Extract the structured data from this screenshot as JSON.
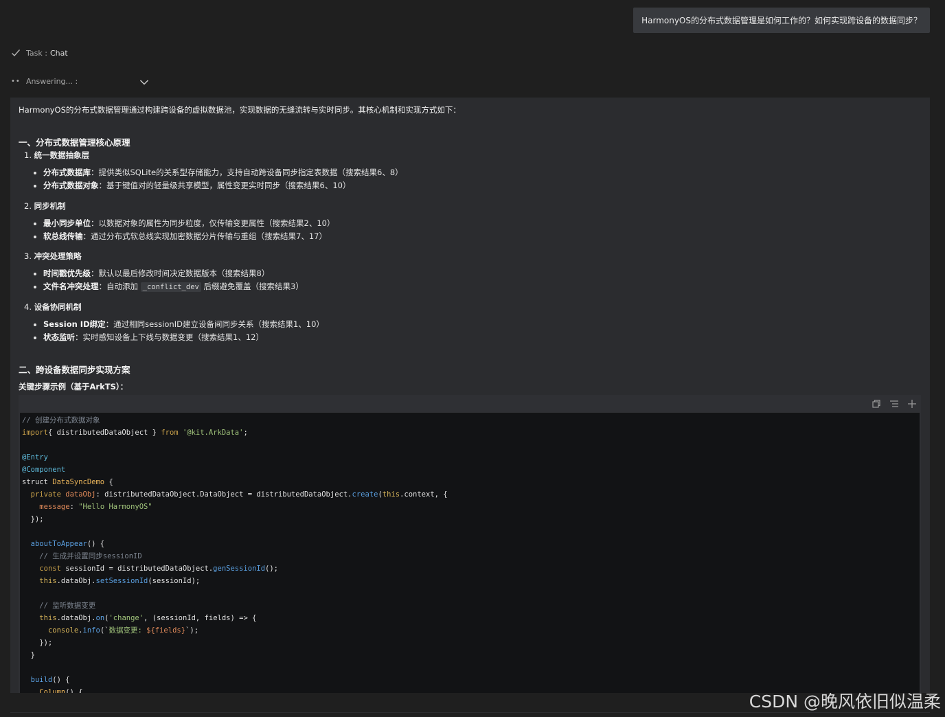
{
  "user_message": "HarmonyOS的分布式数据管理是如何工作的？如何实现跨设备的数据同步？",
  "task": {
    "label": "Task :",
    "value": "Chat"
  },
  "status": {
    "label": "Answering... :"
  },
  "answer": {
    "intro": "HarmonyOS的分布式数据管理通过构建跨设备的虚拟数据池，实现数据的无缝流转与实时同步。其核心机制和实现方式如下：",
    "section1_title": "一、分布式数据管理核心原理",
    "s1_1_num": "1. ",
    "s1_1_title": "统一数据抽象层",
    "s1_1_items": [
      {
        "b": "分布式数据库",
        "t": "：提供类似SQLite的关系型存储能力，支持自动跨设备同步指定表数据（搜索结果6、8）"
      },
      {
        "b": "分布式数据对象",
        "t": "：基于键值对的轻量级共享模型，属性变更实时同步（搜索结果6、10）"
      }
    ],
    "s1_2_num": "2. ",
    "s1_2_title": "同步机制",
    "s1_2_items": [
      {
        "b": "最小同步单位",
        "t": "：以数据对象的属性为同步粒度，仅传输变更属性（搜索结果2、10）"
      },
      {
        "b": "软总线传输",
        "t": "：通过分布式软总线实现加密数据分片传输与重组（搜索结果7、17）"
      }
    ],
    "s1_3_num": "3. ",
    "s1_3_title": "冲突处理策略",
    "s1_3_item1": {
      "b": "时间戳优先级",
      "t": "：默认以最后修改时间决定数据版本（搜索结果8）"
    },
    "s1_3_item2": {
      "b": "文件名冲突处理",
      "pre": "：自动添加 ",
      "code": "_conflict_dev",
      "post": " 后缀避免覆盖（搜索结果3）"
    },
    "s1_4_num": "4. ",
    "s1_4_title": "设备协同机制",
    "s1_4_items": [
      {
        "b": "Session ID绑定",
        "t": "：通过相同sessionID建立设备间同步关系（搜索结果1、10）"
      },
      {
        "b": "状态监听",
        "t": "：实时感知设备上下线与数据变更（搜索结果1、12）"
      }
    ],
    "section2_title": "二、跨设备数据同步实现方案",
    "steps_label": "关键步骤示例（基于ArkTS）："
  },
  "code": {
    "lines": [
      [
        [
          "c-cm",
          "// 创建分布式数据对象"
        ]
      ],
      [
        [
          "c-kw",
          "import"
        ],
        [
          "",
          "{ distributedDataObject } "
        ],
        [
          "c-kw",
          "from"
        ],
        [
          "",
          " "
        ],
        [
          "c-str",
          "'@kit.ArkData'"
        ],
        [
          "",
          ";"
        ]
      ],
      [],
      [
        [
          "c-dec",
          "@Entry"
        ]
      ],
      [
        [
          "c-dec",
          "@Component"
        ]
      ],
      [
        [
          "",
          "struct "
        ],
        [
          "c-ty",
          "DataSyncDemo"
        ],
        [
          "",
          " {"
        ]
      ],
      [
        [
          "",
          "  "
        ],
        [
          "c-kw",
          "private"
        ],
        [
          "",
          " "
        ],
        [
          "c-var",
          "dataObj"
        ],
        [
          "",
          ": distributedDataObject.DataObject = distributedDataObject."
        ],
        [
          "c-fn",
          "create"
        ],
        [
          "",
          "("
        ],
        [
          "c-this",
          "this"
        ],
        [
          "",
          ".context, {"
        ]
      ],
      [
        [
          "",
          "    "
        ],
        [
          "c-var",
          "message"
        ],
        [
          "",
          ": "
        ],
        [
          "c-str",
          "\"Hello HarmonyOS\""
        ]
      ],
      [
        [
          "",
          "  });"
        ]
      ],
      [],
      [
        [
          "",
          "  "
        ],
        [
          "c-fn",
          "aboutToAppear"
        ],
        [
          "",
          "() {"
        ]
      ],
      [
        [
          "",
          "    "
        ],
        [
          "c-cm",
          "// 生成并设置同步sessionID"
        ]
      ],
      [
        [
          "",
          "    "
        ],
        [
          "c-kw",
          "const"
        ],
        [
          "",
          " sessionId = distributedDataObject."
        ],
        [
          "c-fn",
          "genSessionId"
        ],
        [
          "",
          "();"
        ]
      ],
      [
        [
          "",
          "    "
        ],
        [
          "c-this",
          "this"
        ],
        [
          "",
          ".dataObj."
        ],
        [
          "c-fn",
          "setSessionId"
        ],
        [
          "",
          "(sessionId);"
        ]
      ],
      [],
      [
        [
          "",
          "    "
        ],
        [
          "c-cm",
          "// 监听数据变更"
        ]
      ],
      [
        [
          "",
          "    "
        ],
        [
          "c-this",
          "this"
        ],
        [
          "",
          ".dataObj."
        ],
        [
          "c-fn",
          "on"
        ],
        [
          "",
          "("
        ],
        [
          "c-str",
          "'change'"
        ],
        [
          "",
          ", (sessionId, fields) => {"
        ]
      ],
      [
        [
          "",
          "      "
        ],
        [
          "c-this",
          "console"
        ],
        [
          "",
          "."
        ],
        [
          "c-fn",
          "info"
        ],
        [
          "",
          "(`"
        ],
        [
          "c-str",
          "数据变更: "
        ],
        [
          "c-var",
          "${fields}"
        ],
        [
          "",
          "`);"
        ]
      ],
      [
        [
          "",
          "    });"
        ]
      ],
      [
        [
          "",
          "  }"
        ]
      ],
      [],
      [
        [
          "",
          "  "
        ],
        [
          "c-fn",
          "build"
        ],
        [
          "",
          "() {"
        ]
      ],
      [
        [
          "",
          "    "
        ],
        [
          "c-ty",
          "Column"
        ],
        [
          "",
          "() {"
        ]
      ]
    ]
  },
  "watermark": "CSDN @晚风依旧似温柔",
  "icons": [
    "check-icon",
    "loading-dots-icon",
    "chevron-down-icon",
    "copy-icon",
    "list-icon",
    "plus-icon"
  ]
}
